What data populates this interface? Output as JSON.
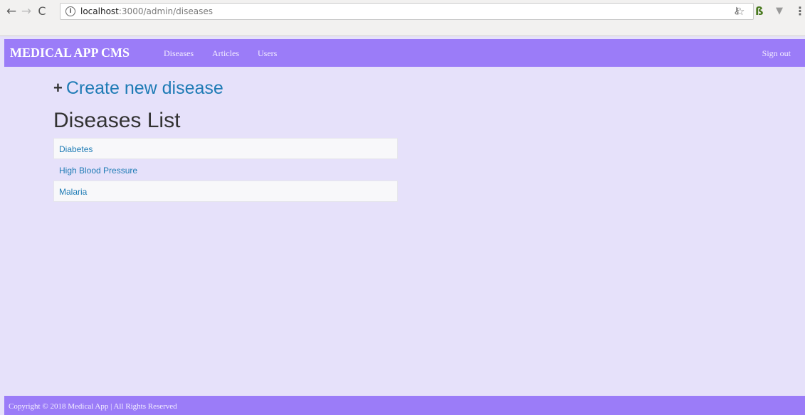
{
  "browser": {
    "url_host": "localhost",
    "url_rest": ":3000/admin/diseases",
    "icons": [
      "back-icon",
      "forward-icon",
      "reload-icon",
      "info-icon",
      "key-icon",
      "star-icon",
      "extension-b-icon",
      "extension-v-icon",
      "menu-icon"
    ]
  },
  "navbar": {
    "brand": "MEDICAL APP CMS",
    "links": [
      {
        "label": "Diseases"
      },
      {
        "label": "Articles"
      },
      {
        "label": "Users"
      }
    ],
    "signout": "Sign out",
    "color": "#9b7cf8"
  },
  "main": {
    "create_label": "Create new disease",
    "list_title": "Diseases List",
    "diseases": [
      {
        "name": "Diabetes"
      },
      {
        "name": "High Blood Pressure"
      },
      {
        "name": "Malaria"
      }
    ],
    "link_color": "#1e7bb5",
    "background": "#e6e1fa"
  },
  "footer": {
    "copyright": "Copyright © 2018 Medical App | All Rights Reserved"
  }
}
